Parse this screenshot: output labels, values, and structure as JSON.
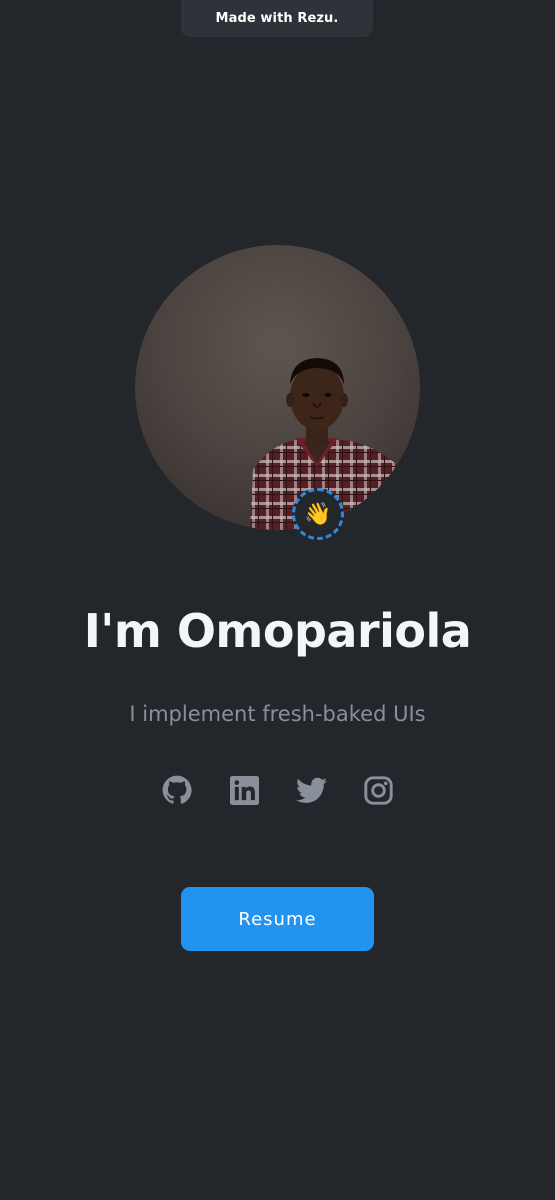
{
  "banner": {
    "text": "Made with Rezu."
  },
  "profile": {
    "avatar_icon": "person-portrait",
    "wave_emoji": "👋",
    "heading": "I'm Omopariola",
    "tagline": "I implement fresh-baked UIs"
  },
  "socials": [
    {
      "icon": "github-icon"
    },
    {
      "icon": "linkedin-icon"
    },
    {
      "icon": "twitter-icon"
    },
    {
      "icon": "instagram-icon"
    }
  ],
  "cta": {
    "resume_label": "Resume"
  },
  "colors": {
    "background": "#23262b",
    "accent": "#2294f0",
    "icon": "#8a9099"
  }
}
